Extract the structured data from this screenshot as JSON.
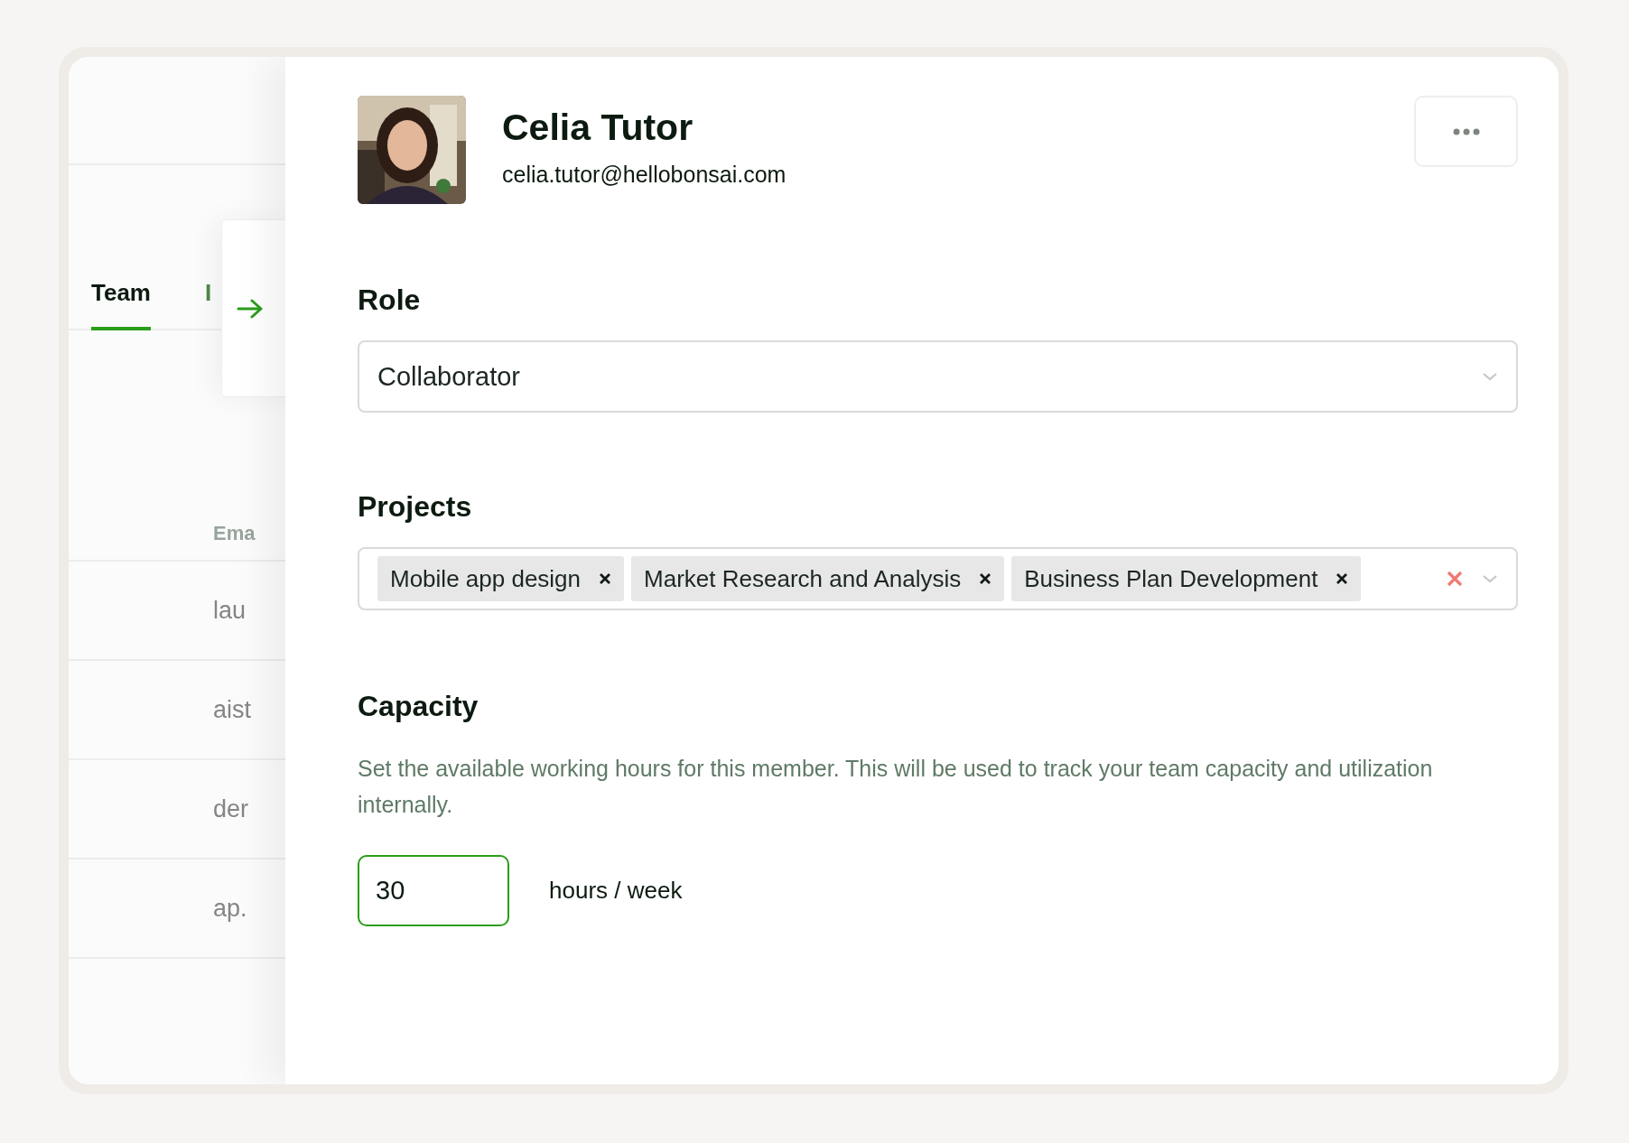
{
  "sidebar": {
    "tabs": [
      {
        "label": "Team",
        "selected": true
      },
      {
        "label": "I",
        "selected": false
      }
    ],
    "column_header": "Ema",
    "rows": [
      "lau",
      "aist",
      "der",
      "ap."
    ]
  },
  "profile": {
    "name": "Celia Tutor",
    "email": "celia.tutor@hellobonsai.com"
  },
  "role": {
    "heading": "Role",
    "value": "Collaborator"
  },
  "projects": {
    "heading": "Projects",
    "tags": [
      "Mobile app design",
      "Market Research and Analysis",
      "Business Plan Development"
    ]
  },
  "capacity": {
    "heading": "Capacity",
    "description": "Set the available working hours for this member. This will be used to track your team capacity and utilization internally.",
    "value": "30",
    "unit": "hours / week"
  }
}
